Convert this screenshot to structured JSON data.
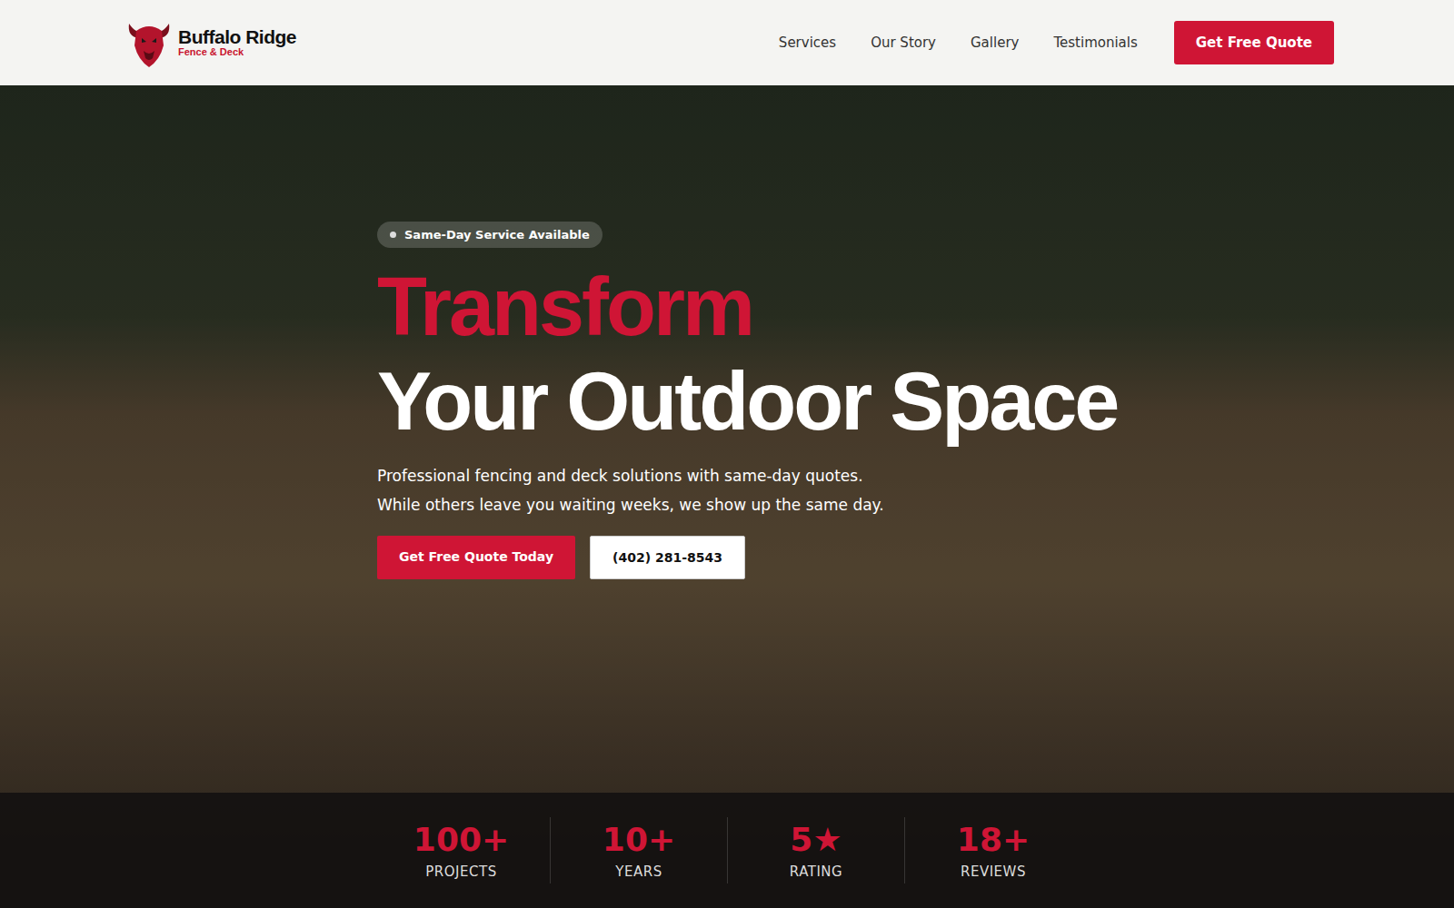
{
  "header": {
    "logo": {
      "title": "Buffalo Ridge",
      "subtitle": "Fence & Deck"
    },
    "nav": [
      {
        "label": "Services"
      },
      {
        "label": "Our Story"
      },
      {
        "label": "Gallery"
      },
      {
        "label": "Testimonials"
      }
    ],
    "cta": "Get Free Quote"
  },
  "hero": {
    "badge": "Same-Day Service Available",
    "title_accent": "Transform",
    "title": "Your Outdoor Space",
    "subtitle": [
      "Professional fencing and deck solutions with same-day quotes.",
      "While others leave you waiting weeks, we show up the same day."
    ],
    "buttons": [
      {
        "label": "Get Free Quote Today",
        "kind": "primary"
      },
      {
        "label": "(402) 281-8543",
        "kind": "secondary"
      }
    ]
  },
  "stats": [
    {
      "value": "100+",
      "label": "PROJECTS"
    },
    {
      "value": "10+",
      "label": "YEARS"
    },
    {
      "value": "5★",
      "label": "RATING"
    },
    {
      "value": "18+",
      "label": "REVIEWS"
    }
  ]
}
